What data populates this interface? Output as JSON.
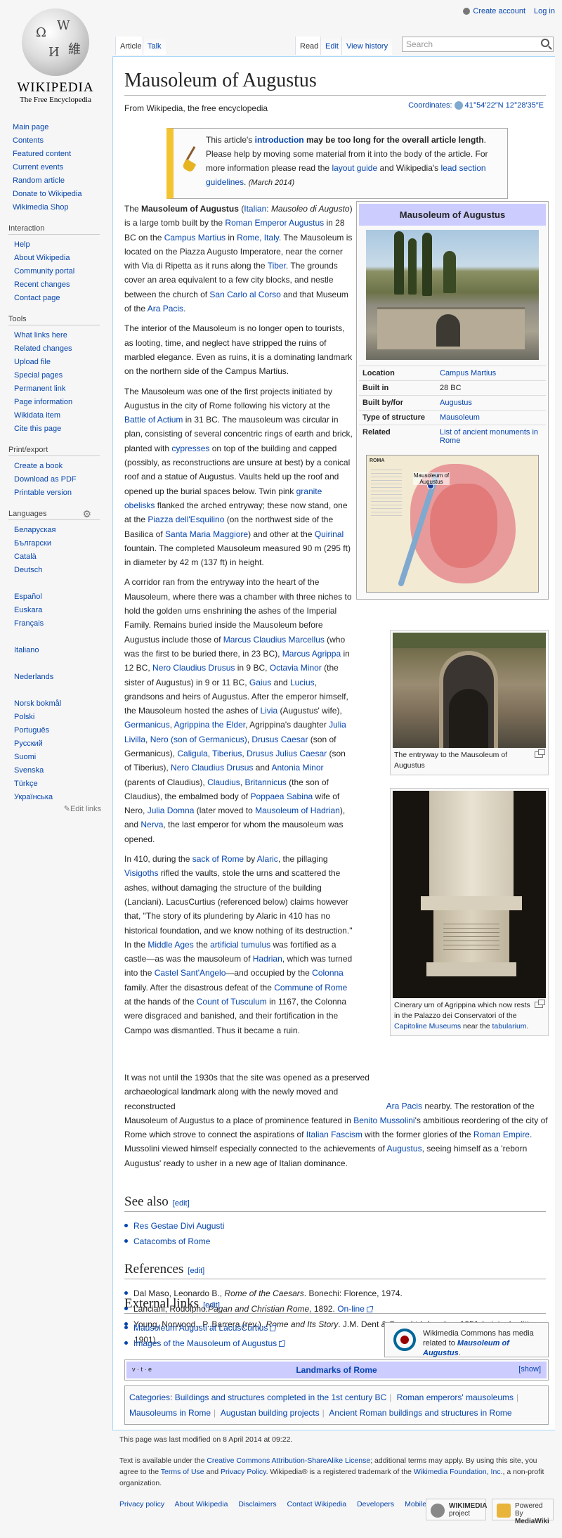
{
  "personal": {
    "create_account": "Create account",
    "log_in": "Log in"
  },
  "logo": {
    "wordmark": "WIKIPEDIA",
    "tagline": "The Free Encyclopedia"
  },
  "sidebar": {
    "navigation": [
      "Main page",
      "Contents",
      "Featured content",
      "Current events",
      "Random article",
      "Donate to Wikipedia",
      "Wikimedia Shop"
    ],
    "interaction": {
      "heading": "Interaction",
      "items": [
        "Help",
        "About Wikipedia",
        "Community portal",
        "Recent changes",
        "Contact page"
      ]
    },
    "tools": {
      "heading": "Tools",
      "items": [
        "What links here",
        "Related changes",
        "Upload file",
        "Special pages",
        "Permanent link",
        "Page information",
        "Wikidata item",
        "Cite this page"
      ]
    },
    "print": {
      "heading": "Print/export",
      "items": [
        "Create a book",
        "Download as PDF",
        "Printable version"
      ]
    },
    "languages": {
      "heading": "Languages",
      "group1": [
        "Беларуская",
        "Български",
        "Català",
        "Deutsch"
      ],
      "group2": [
        "Español",
        "Euskara",
        "Français"
      ],
      "group3": [
        "Italiano"
      ],
      "group4": [
        "Nederlands"
      ],
      "group5": [
        "Norsk bokmål",
        "Polski",
        "Português",
        "Русский",
        "Suomi",
        "Svenska",
        "Türkçe",
        "Українська"
      ],
      "edit_links": "Edit links"
    }
  },
  "tabs": {
    "article": "Article",
    "talk": "Talk",
    "read": "Read",
    "edit": "Edit",
    "history": "View history"
  },
  "search": {
    "placeholder": "Search"
  },
  "article": {
    "title": "Mausoleum of Augustus",
    "tagline": "From Wikipedia, the free encyclopedia",
    "coords_label": "Coordinates:",
    "coords": "41°54′22″N 12°28′35″E",
    "ambox": {
      "t1": "This article's ",
      "l1": "introduction",
      "t2": " may be too long for the overall article length",
      "t3": ". Please help by moving some material from it into the body of the article. For more information please read the ",
      "l2": "layout guide",
      "t4": " and Wikipedia's ",
      "l3": "lead section guidelines",
      "t5": ". ",
      "date": "(March 2014)"
    },
    "infobox": {
      "title": "Mausoleum of Augustus",
      "rows": [
        {
          "label": "Location",
          "value": "Campus Martius"
        },
        {
          "label": "Built in",
          "value": "28 BC"
        },
        {
          "label": "Built by/for",
          "value": "Augustus"
        },
        {
          "label": "Type of structure",
          "value": "Mausoleum"
        },
        {
          "label": "Related",
          "value": "List of ancient monuments in Rome"
        }
      ],
      "map_label": "Mausoleum of Augustus",
      "map_header": "ROMA"
    },
    "thumb1_caption": "The entryway to the Mausoleum of Augustus",
    "thumb2": {
      "c1": "Cinerary urn of Agrippina which now rests in the Palazzo dei Conservatori of the ",
      "l1": "Capitoline Museums",
      "c2": " near the ",
      "l2": "tabularium",
      "c3": "."
    },
    "see_also": {
      "heading": "See also",
      "edit": "[edit]",
      "items": [
        "Res Gestae Divi Augusti",
        "Catacombs of Rome"
      ]
    },
    "references": {
      "heading": "References",
      "edit": "[edit]",
      "r1a": "Dal Maso, Leonardo B., ",
      "r1b": "Rome of the Caesars",
      "r1c": ". Bonechi: Florence, 1974.",
      "r2a": "Lanciani, Rodolpho.",
      "r2b": "Pagan and Christian Rome",
      "r2c": ", 1892. ",
      "r2d": "On-line",
      "r3a": "Young, Norwood., P. Barrera (rev.). ",
      "r3b": "Rome and Its Story",
      "r3c": ". J.M. Dent & Sons Ltd: London, 1951 (original edition, 1901)."
    },
    "external": {
      "heading": "External links",
      "edit": "[edit]",
      "items": [
        "Mausoleum Augusti at LacusCurtius",
        "Images of the Mausoleum of Augustus"
      ]
    },
    "commons": {
      "t1": "Wikimedia Commons has media related to ",
      "l1": "Mausoleum of Augustus",
      "t2": "."
    },
    "navbox": {
      "vte": "v · t · e",
      "title": "Landmarks of Rome",
      "show": "[show]"
    },
    "categories": {
      "label": "Categories",
      "items": [
        "Buildings and structures completed in the 1st century BC",
        "Roman emperors' mausoleums",
        "Mausoleums in Rome",
        "Augustan building projects",
        "Ancient Roman buildings and structures in Rome"
      ]
    }
  },
  "footer": {
    "lastmod": "This page was last modified on 8 April 2014 at 09:22.",
    "lic1": "Text is available under the ",
    "lic_link": "Creative Commons Attribution-ShareAlike License",
    "lic2": "; additional terms may apply. By using this site, you agree to the ",
    "terms": "Terms of Use",
    "lic3": " and ",
    "privacy": "Privacy Policy",
    "lic4": ". Wikipedia® is a registered trademark of the ",
    "wmf": "Wikimedia Foundation, Inc.",
    "lic5": ", a non-profit organization.",
    "places": [
      "Privacy policy",
      "About Wikipedia",
      "Disclaimers",
      "Contact Wikipedia",
      "Developers",
      "Mobile view"
    ],
    "badge1": [
      "WIKIMEDIA",
      "project"
    ],
    "badge2": [
      "Powered By",
      "MediaWiki"
    ]
  }
}
